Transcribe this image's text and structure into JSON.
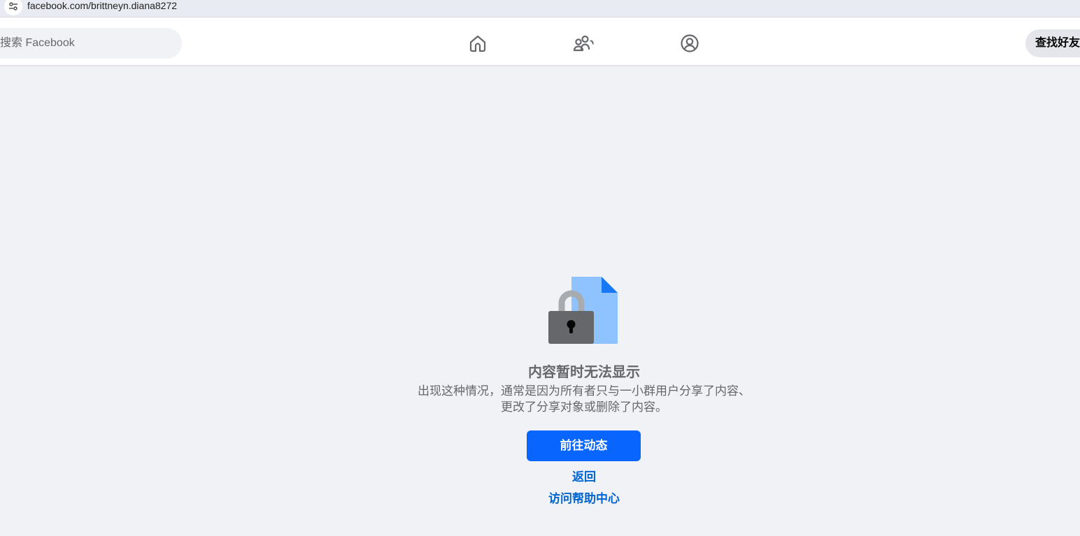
{
  "browser": {
    "url": "facebook.com/brittneyn.diana8272",
    "site_info_icon": "tune-icon"
  },
  "header": {
    "search_placeholder": "搜索 Facebook",
    "nav_icons": [
      "home-icon",
      "friends-icon",
      "profile-icon"
    ],
    "find_friends_label": "查找好友"
  },
  "error": {
    "illustration": "locked-document",
    "title": "内容暂时无法显示",
    "description": "出现这种情况，通常是因为所有者只与一小群用户分享了内容、更改了分享对象或删除了内容。",
    "primary_button": "前往动态",
    "back_link": "返回",
    "help_link": "访问帮助中心"
  },
  "colors": {
    "page_background": "#f0f2f5",
    "primary_blue": "#0866ff",
    "link_blue": "#0064d1",
    "secondary_text": "#65676b",
    "doc_blue_light": "#8fc3ff",
    "doc_blue_dark": "#1877f2",
    "lock_body": "#65676b"
  }
}
